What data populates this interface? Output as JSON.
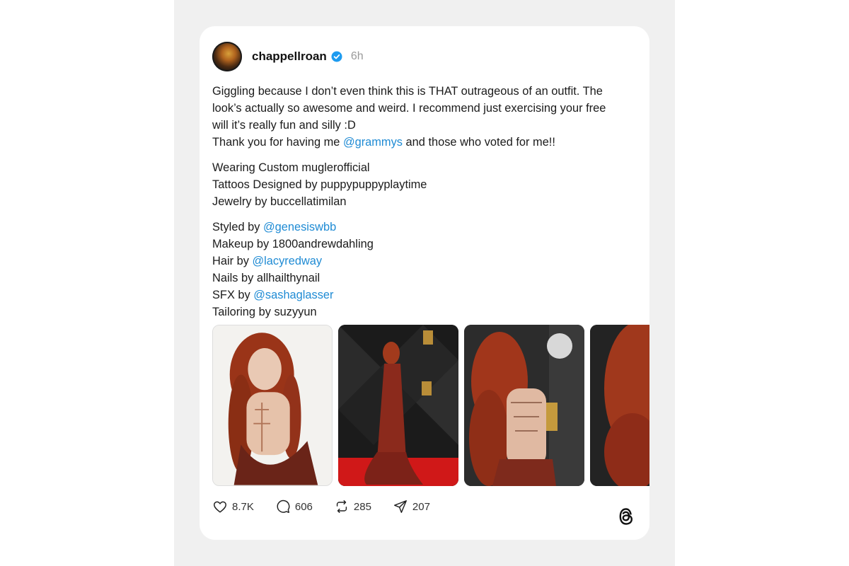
{
  "post": {
    "username": "chappellroan",
    "verified": true,
    "time": "6h",
    "paragraph1": [
      "Giggling because I don’t even think this is THAT outrageous of an outfit. The",
      "look’s actually so awesome and weird. I recommend just exercising your free",
      "will it’s really fun and silly :D"
    ],
    "thanks_prefix": "Thank you for having me ",
    "thanks_mention": "@grammys",
    "thanks_suffix": " and those who voted for me!!",
    "paragraph2": [
      "Wearing Custom muglerofficial",
      "Tattoos Designed by puppypuppyplaytime",
      "Jewelry by buccellatimilan"
    ],
    "credits": [
      {
        "prefix": "Styled by ",
        "mention": "@genesiswbb"
      },
      {
        "prefix": "Makeup by 1800andrewdahling",
        "mention": ""
      },
      {
        "prefix": "Hair by ",
        "mention": "@lacyredway"
      },
      {
        "prefix": "Nails by allhailthynail",
        "mention": ""
      },
      {
        "prefix": "SFX by ",
        "mention": "@sashaglasser"
      },
      {
        "prefix": "Tailoring by suzyyun",
        "mention": ""
      }
    ]
  },
  "stats": {
    "likes": "8.7K",
    "replies": "606",
    "reposts": "285",
    "shares": "207"
  },
  "icons": {
    "like": "heart-icon",
    "reply": "comment-icon",
    "repost": "repost-icon",
    "share": "send-icon",
    "brand": "threads-logo-icon",
    "verified": "verified-badge-icon"
  },
  "colors": {
    "mention": "#1f8bd4",
    "verified": "#1d9bf0",
    "background": "#f0f0f0",
    "card": "#ffffff"
  }
}
